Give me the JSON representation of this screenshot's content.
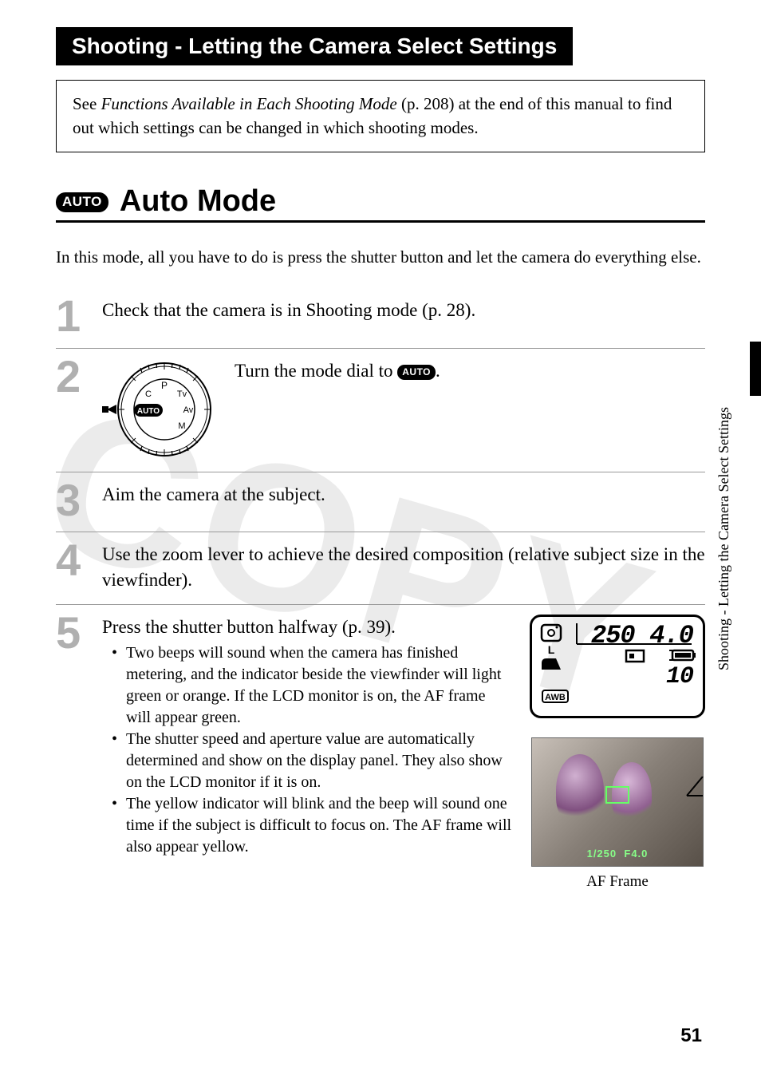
{
  "side_tab_text": "Shooting - Letting the Camera Select Settings",
  "chapter_title": "Shooting - Letting the Camera Select Settings",
  "note_intro": "See ",
  "note_italic": "Functions Available in Each Shooting Mode",
  "note_rest": " (p. 208) at the end of this manual to find out which settings can be changed in which shooting modes.",
  "section": {
    "pill": "AUTO",
    "title": "Auto Mode"
  },
  "intro": "In this mode, all you have to do is press the shutter button and let the camera do everything else.",
  "steps": {
    "s1": {
      "num": "1",
      "text": "Check that the camera is in Shooting mode (p. 28)."
    },
    "s2": {
      "num": "2",
      "text_before": "Turn the mode dial to ",
      "pill": "AUTO",
      "text_after": "."
    },
    "s3": {
      "num": "3",
      "text": "Aim the camera at the subject."
    },
    "s4": {
      "num": "4",
      "text": "Use the zoom lever to achieve the desired composition (relative subject size in the viewfinder)."
    },
    "s5": {
      "num": "5",
      "heading": "Press the shutter button halfway (p. 39).",
      "bullets": [
        "Two beeps will sound when the camera has finished metering, and the indicator beside the viewfinder will light green or orange. If the LCD monitor is on, the AF frame will appear green.",
        "The shutter speed and aperture value are automatically determined and show on the display panel. They also show on the LCD monitor if it is on.",
        "The yellow indicator will blink and the beep will sound one time if the subject is difficult to focus on. The AF frame will also appear yellow."
      ]
    }
  },
  "lcd": {
    "shutter": "250",
    "aperture": "4.0",
    "shots": "10",
    "size": "L",
    "awb": "AWB"
  },
  "photo": {
    "shutter": "1/250",
    "aperture": "F4.0",
    "caption": "AF Frame"
  },
  "watermark": "COPY",
  "page_number": "51"
}
